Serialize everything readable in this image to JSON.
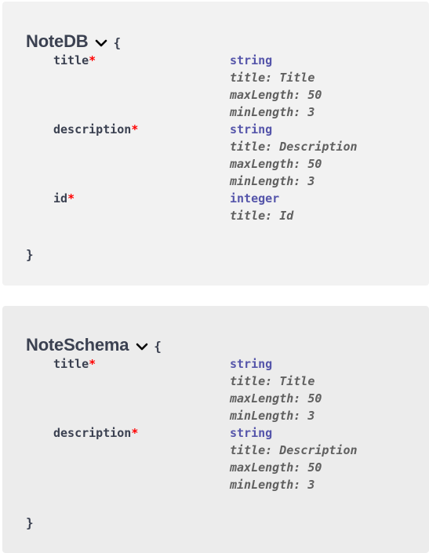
{
  "models": [
    {
      "name": "NoteDB",
      "open_brace": "{",
      "close_brace": "}",
      "properties": [
        {
          "name": "title",
          "required_mark": "*",
          "type": "string",
          "constraints": [
            "title: Title",
            "maxLength: 50",
            "minLength: 3"
          ]
        },
        {
          "name": "description",
          "required_mark": "*",
          "type": "string",
          "constraints": [
            "title: Description",
            "maxLength: 50",
            "minLength: 3"
          ]
        },
        {
          "name": "id",
          "required_mark": "*",
          "type": "integer",
          "constraints": [
            "title: Id"
          ]
        }
      ]
    },
    {
      "name": "NoteSchema",
      "open_brace": "{",
      "close_brace": "}",
      "properties": [
        {
          "name": "title",
          "required_mark": "*",
          "type": "string",
          "constraints": [
            "title: Title",
            "maxLength: 50",
            "minLength: 3"
          ]
        },
        {
          "name": "description",
          "required_mark": "*",
          "type": "string",
          "constraints": [
            "title: Description",
            "maxLength: 50",
            "minLength: 3"
          ]
        }
      ]
    }
  ],
  "colors": {
    "required": "#ff0000",
    "type": "#55a",
    "text": "#3b4151",
    "meta": "#606060"
  },
  "icons": {
    "toggle": "chevron-down-icon"
  }
}
